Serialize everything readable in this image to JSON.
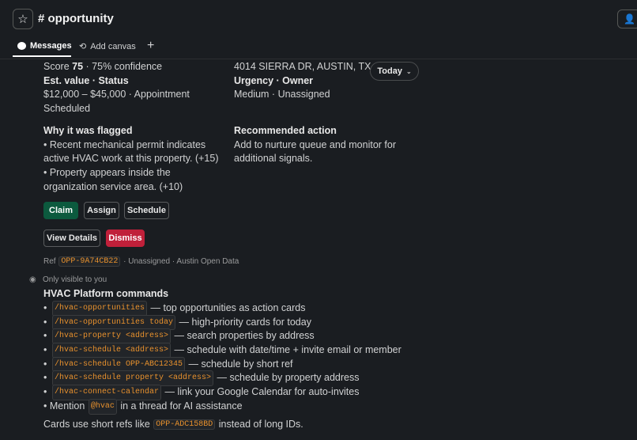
{
  "header": {
    "channel_title": "# opportunity"
  },
  "tabs": {
    "messages": "Messages",
    "add_canvas": "Add canvas",
    "add": "+"
  },
  "card": {
    "score_prefix": "Score",
    "score_value": "75",
    "score_suffix": "· 75% confidence",
    "est_value_label": "Est. value · Status",
    "est_value": "$12,000 – $45,000 · Appointment Scheduled",
    "address": "4014 SIERRA DR, AUSTIN, TX",
    "urgency_label": "Urgency · Owner",
    "urgency_value": "Medium · Unassigned",
    "why_label": "Why it was flagged",
    "why_items": [
      "• Recent mechanical permit indicates active HVAC work at this property. (+15)",
      "• Property appears inside the organization service area. (+10)"
    ],
    "rec_label": "Recommended action",
    "rec_value": "Add to nurture queue and monitor for additional signals.",
    "today_label": "Today",
    "buttons": {
      "claim": "Claim",
      "assign": "Assign",
      "schedule": "Schedule",
      "view_details": "View Details",
      "dismiss": "Dismiss"
    },
    "ref_prefix": "Ref",
    "ref_code": "OPP-9A74CB22",
    "ref_suffix": "· Unassigned · Austin Open Data"
  },
  "help": {
    "visibility": "Only visible to you",
    "title": "HVAC Platform commands",
    "commands": [
      {
        "code": "/hvac-opportunities",
        "desc": "— top opportunities as action cards"
      },
      {
        "code": "/hvac-opportunities today",
        "desc": "— high-priority cards for today"
      },
      {
        "code": "/hvac-property <address>",
        "desc": "— search properties by address"
      },
      {
        "code": "/hvac-schedule <address>",
        "desc": "— schedule with date/time + invite email or member"
      },
      {
        "code": "/hvac-schedule OPP-ABC12345",
        "desc": "— schedule by short ref"
      },
      {
        "code": "/hvac-schedule property <address>",
        "desc": "— schedule by property address"
      },
      {
        "code": "/hvac-connect-calendar",
        "desc": "— link your Google Calendar for auto-invites"
      }
    ],
    "mention_prefix": "• Mention",
    "mention_code": "@hvac",
    "mention_suffix": "in a thread for AI assistance",
    "footer_prefix": "Cards use short refs like",
    "footer_code": "OPP-ADC158BD",
    "footer_suffix": "instead of long IDs."
  }
}
